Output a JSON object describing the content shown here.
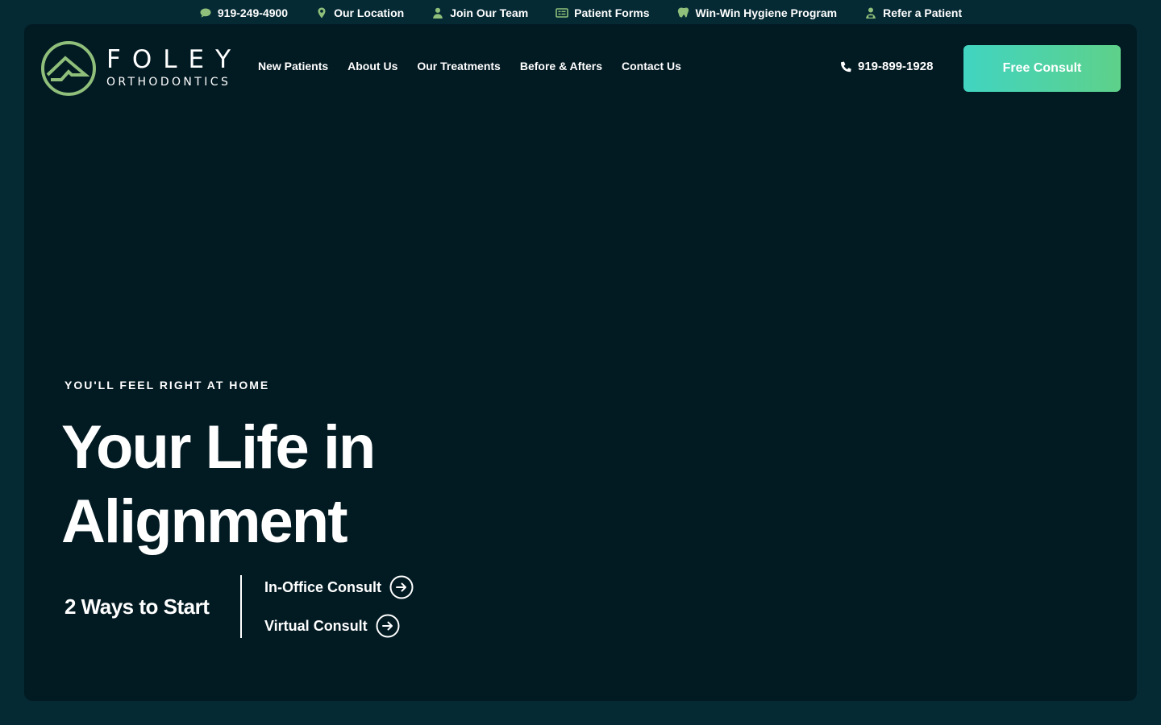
{
  "utility_bar": {
    "items": [
      {
        "label": "919-249-4900",
        "icon": "chat-bubble-icon"
      },
      {
        "label": "Our Location",
        "icon": "map-pin-icon"
      },
      {
        "label": "Join Our Team",
        "icon": "person-icon"
      },
      {
        "label": "Patient Forms",
        "icon": "form-icon"
      },
      {
        "label": "Win-Win Hygiene Program",
        "icon": "tooth-icon"
      },
      {
        "label": "Refer a Patient",
        "icon": "referral-person-icon"
      }
    ]
  },
  "header": {
    "logo": {
      "name": "FOLEY",
      "sub": "ORTHODONTICS"
    },
    "nav": [
      "New Patients",
      "About Us",
      "Our Treatments",
      "Before & Afters",
      "Contact Us"
    ],
    "phone": "919-899-1928",
    "cta": "Free Consult"
  },
  "hero": {
    "eyebrow": "YOU'LL FEEL RIGHT AT HOME",
    "headline_line1": "Your Life in",
    "headline_line2": "Alignment",
    "ways_label": "2 Ways to Start",
    "links": [
      "In-Office Consult",
      "Virtual Consult"
    ]
  },
  "colors": {
    "page_background": "#052a34",
    "card_background": "#021a22",
    "accent_green": "#8fbf7a",
    "cta_gradient_start": "#41d4c1",
    "cta_gradient_end": "#5ed18a"
  }
}
